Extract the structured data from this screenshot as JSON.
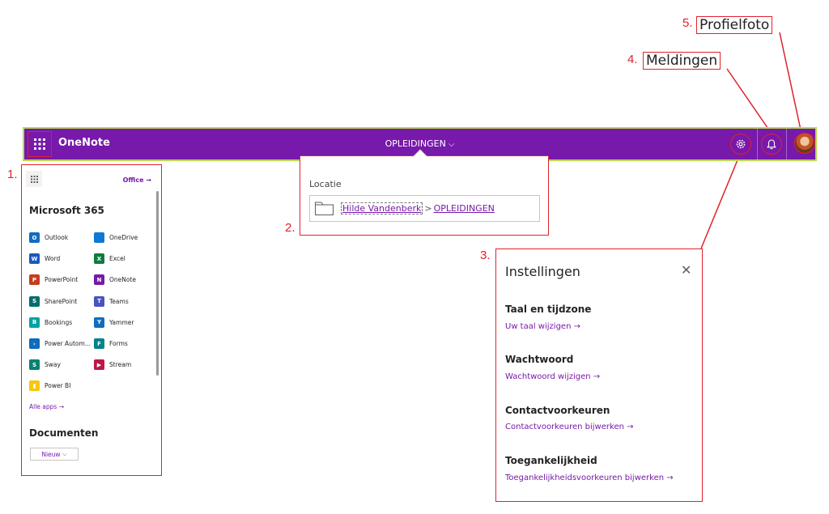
{
  "callouts": {
    "c1": {
      "num": "1."
    },
    "c2": {
      "num": "2."
    },
    "c3": {
      "num": "3."
    },
    "c4": {
      "num": "4.",
      "label": "Meldingen"
    },
    "c5": {
      "num": "5.",
      "label": "Profielfoto"
    }
  },
  "topbar": {
    "app_name": "OneNote",
    "notebook": "OPLEIDINGEN",
    "accent": "#7719aa"
  },
  "launcher": {
    "office_link": "Office",
    "section_title": "Microsoft 365",
    "apps": [
      {
        "label": "Outlook",
        "icon": "outlook-icon",
        "color": "#0f6cbd",
        "letter": "O"
      },
      {
        "label": "OneDrive",
        "icon": "onedrive-icon",
        "color": "#0f78d4",
        "letter": ""
      },
      {
        "label": "Word",
        "icon": "word-icon",
        "color": "#185abd",
        "letter": "W"
      },
      {
        "label": "Excel",
        "icon": "excel-icon",
        "color": "#107c41",
        "letter": "X"
      },
      {
        "label": "PowerPoint",
        "icon": "powerpoint-icon",
        "color": "#c43e1c",
        "letter": "P"
      },
      {
        "label": "OneNote",
        "icon": "onenote-icon",
        "color": "#7719aa",
        "letter": "N"
      },
      {
        "label": "SharePoint",
        "icon": "sharepoint-icon",
        "color": "#036c70",
        "letter": "S"
      },
      {
        "label": "Teams",
        "icon": "teams-icon",
        "color": "#4b53bc",
        "letter": "T"
      },
      {
        "label": "Bookings",
        "icon": "bookings-icon",
        "color": "#00a3a3",
        "letter": "B"
      },
      {
        "label": "Yammer",
        "icon": "yammer-icon",
        "color": "#106ebe",
        "letter": "Y"
      },
      {
        "label": "Power Autom...",
        "icon": "power-automate-icon",
        "color": "#0f6cbd",
        "letter": "›"
      },
      {
        "label": "Forms",
        "icon": "forms-icon",
        "color": "#038387",
        "letter": "F"
      },
      {
        "label": "Sway",
        "icon": "sway-icon",
        "color": "#008272",
        "letter": "S"
      },
      {
        "label": "Stream",
        "icon": "stream-icon",
        "color": "#bc1948",
        "letter": "▶"
      },
      {
        "label": "Power BI",
        "icon": "power-bi-icon",
        "color": "#f2c811",
        "letter": "▮"
      }
    ],
    "all_apps": "Alle apps",
    "documents_title": "Documenten",
    "new_button": "Nieuw"
  },
  "location": {
    "label": "Locatie",
    "path_owner": "Hilde Vandenberk",
    "path_separator": ">",
    "path_notebook": "OPLEIDINGEN"
  },
  "settings": {
    "title": "Instellingen",
    "sections": [
      {
        "heading": "Taal en tijdzone",
        "link": "Uw taal wijzigen →"
      },
      {
        "heading": "Wachtwoord",
        "link": "Wachtwoord wijzigen →"
      },
      {
        "heading": "Contactvoorkeuren",
        "link": "Contactvoorkeuren bijwerken →"
      },
      {
        "heading": "Toegankelijkheid",
        "link": "Toegankelijkheidsvoorkeuren bijwerken →"
      }
    ]
  }
}
